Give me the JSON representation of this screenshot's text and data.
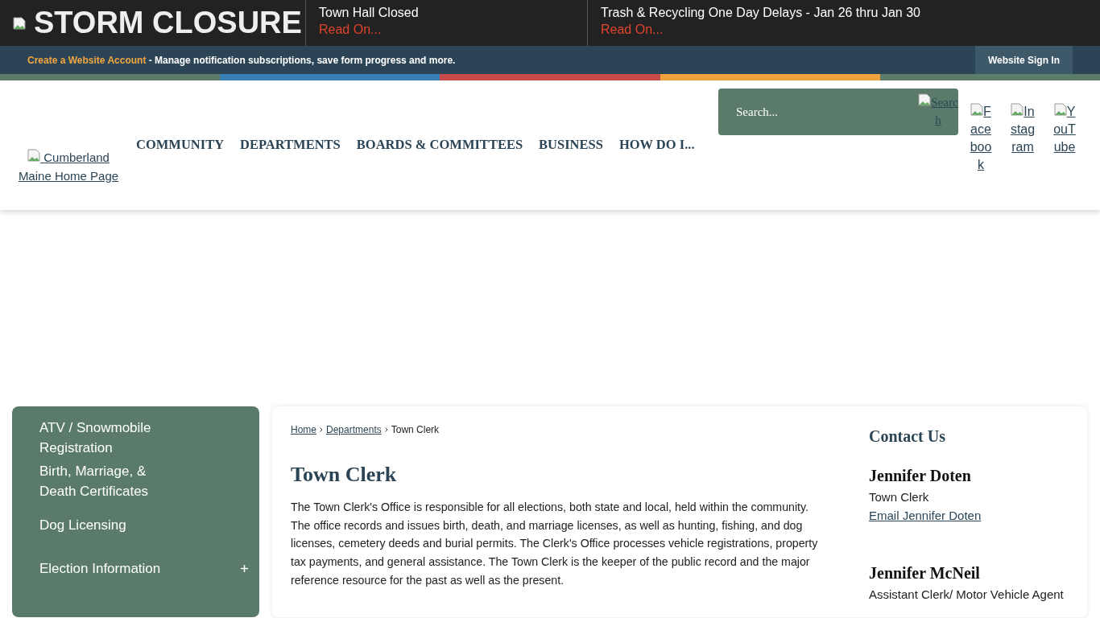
{
  "alert_bar": {
    "title": "STORM CLOSURE",
    "alerts": [
      {
        "headline": "Town Hall Closed",
        "link": "Read On..."
      },
      {
        "headline": "Trash & Recycling One Day Delays - Jan 26 thru Jan 30",
        "link": "Read On..."
      }
    ]
  },
  "account_bar": {
    "link": "Create a Website Account",
    "text": " - Manage notification subscriptions, save form progress and more.",
    "sign_in": "Website Sign In"
  },
  "header": {
    "logo_alt": "Cumberland Maine Home Page",
    "nav": [
      "COMMUNITY",
      "DEPARTMENTS",
      "BOARDS & COMMITTEES",
      "BUSINESS",
      "HOW DO I..."
    ],
    "search": {
      "placeholder": "Search...",
      "button_alt": "Search"
    },
    "social": [
      "Facebook",
      "Instagram",
      "YouTube"
    ]
  },
  "sidebar": {
    "items": [
      {
        "label": "ATV / Snowmobile Registration",
        "expandable": false
      },
      {
        "label": "Birth, Marriage, & Death Certificates",
        "expandable": false
      },
      {
        "label": "Dog Licensing",
        "expandable": false
      },
      {
        "label": "Election Information",
        "expandable": true
      }
    ]
  },
  "content": {
    "breadcrumb": [
      {
        "label": "Home",
        "link": true
      },
      {
        "label": "Departments",
        "link": true
      },
      {
        "label": "Town Clerk",
        "link": false
      }
    ],
    "title": "Town Clerk",
    "body": "The Town Clerk's Office is responsible for all elections, both state and local, held within the community. The office records and issues birth, death, and marriage licenses, as well as hunting, fishing, and dog licenses, cemetery deeds and burial permits. The Clerk's Office processes vehicle registrations, property tax payments, and general assistance. The Town Clerk is the keeper of the public record and the major reference resource for the past as well as the present.",
    "contact": {
      "title": "Contact Us",
      "people": [
        {
          "name": "Jennifer Doten",
          "role": "Town Clerk",
          "email": "Email Jennifer Doten"
        },
        {
          "name": "Jennifer McNeil",
          "role": "Assistant Clerk/ Motor Vehicle Agent"
        }
      ]
    }
  }
}
